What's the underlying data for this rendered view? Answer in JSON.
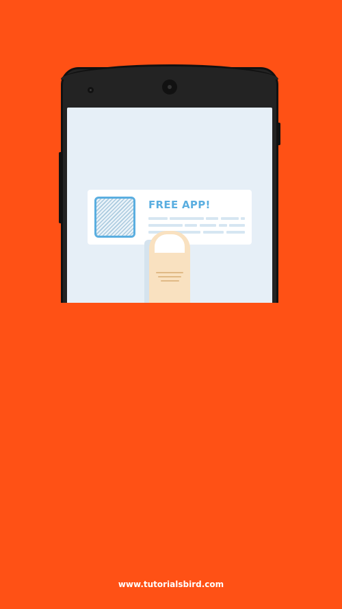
{
  "ad": {
    "title": "FREE APP!"
  },
  "footer": {
    "url": "www.tutorialsbird.com"
  },
  "icons": {
    "app_icon": "hatched-square-icon",
    "camera": "camera-icon",
    "sensor": "sensor-icon"
  },
  "colors": {
    "background": "#ff5115",
    "phone_body": "#232323",
    "screen": "#e6eff7",
    "accent": "#5aaee0",
    "finger": "#f9e1c0"
  }
}
